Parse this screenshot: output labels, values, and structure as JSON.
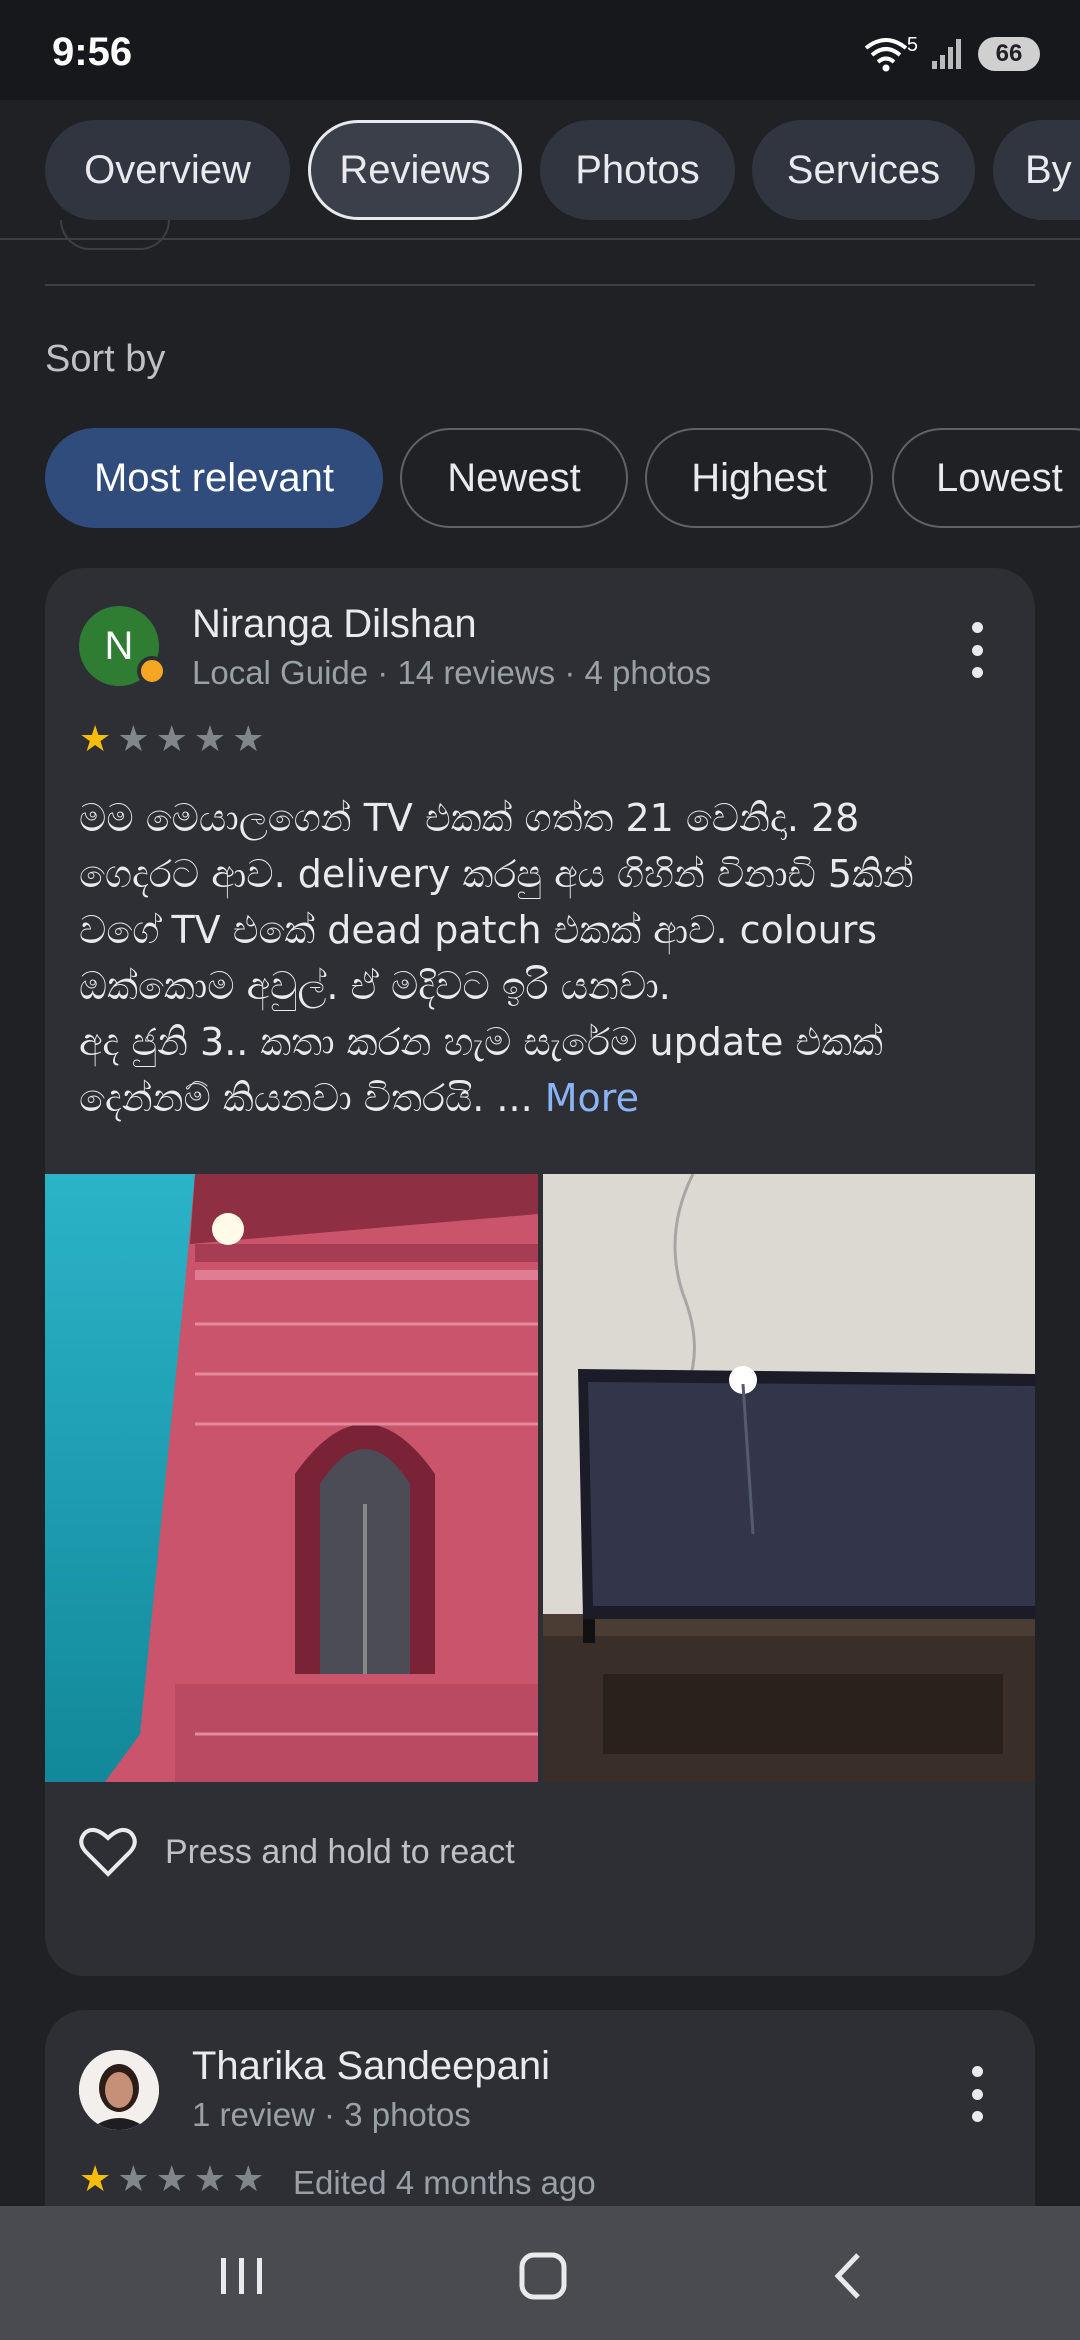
{
  "status_bar": {
    "time": "9:56",
    "wifi_badge": "5",
    "battery": "66"
  },
  "tabs": [
    {
      "label": "Overview",
      "active": false
    },
    {
      "label": "Reviews",
      "active": true
    },
    {
      "label": "Photos",
      "active": false
    },
    {
      "label": "Services",
      "active": false
    },
    {
      "label": "By",
      "active": false
    }
  ],
  "sort": {
    "label": "Sort by",
    "options": [
      {
        "label": "Most relevant",
        "selected": true
      },
      {
        "label": "Newest",
        "selected": false
      },
      {
        "label": "Highest",
        "selected": false
      },
      {
        "label": "Lowest",
        "selected": false
      }
    ]
  },
  "reviews": [
    {
      "avatar_initial": "N",
      "name": "Niranga Dilshan",
      "meta": "Local Guide · 14 reviews · 4 photos",
      "rating": 1,
      "text_lines": [
        "මම මෙයාලගෙන් TV එකක් ගත්ත 21 වෙනිදා. 28",
        "ගෙදරට ආව. delivery කරපු අය ගිහින් විනාඩි 5කින්",
        "වගේ TV එකේ dead patch එකක් ආව. colours",
        "ඔක්කොම අවුල්. ඒ මදිවට ඉරි යනවා.",
        "අද ජුනි 3.. කතා කරන හැම සැරේම update එකක්",
        "දෙන්නම් කියනවා විතරයි. ..."
      ],
      "more_label": "More",
      "react_label": "Press and hold to react"
    },
    {
      "name": "Tharika Sandeepani",
      "meta": "1 review · 3 photos",
      "rating": 1,
      "edited": "Edited 4 months ago"
    }
  ],
  "icons": {
    "wifi": "wifi-icon",
    "signal": "signal-icon",
    "battery": "battery-icon",
    "more": "more-vert-icon",
    "heart": "heart-outline-icon",
    "nav_recents": "recents-icon",
    "nav_home": "home-icon",
    "nav_back": "back-icon"
  },
  "colors": {
    "background": "#202124",
    "card": "#2d2f34",
    "selected_chip": "#2f4c7c",
    "link": "#8ab4f8",
    "star_filled": "#fbbc04"
  }
}
